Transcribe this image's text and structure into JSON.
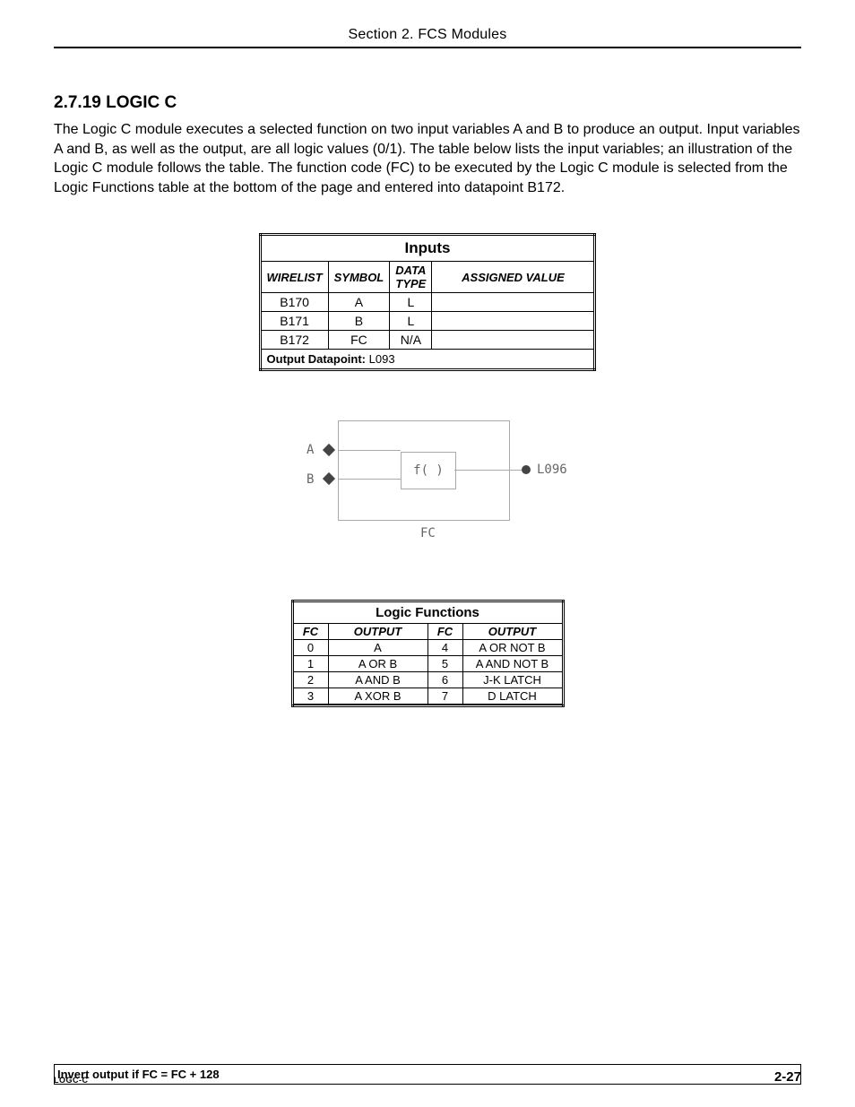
{
  "header": {
    "section_title": "Section 2. FCS Modules"
  },
  "chapter": {
    "number_title": "2.7.19  LOGIC C",
    "body": "The Logic C module executes a selected function on two input variables A and B to produce an output.  Input variables A and B, as well as the output, are all logic values (0/1).  The table below lists the input variables; an illustration of the Logic C module follows the table.  The function code (FC) to be executed by the Logic C module is selected from the Logic Functions table at the bottom of the page and entered into datapoint B172."
  },
  "inputs_table": {
    "title": "Inputs",
    "headers": {
      "wirelist": "WIRELIST",
      "symbol": "SYMBOL",
      "datatype_line1": "DATA",
      "datatype_line2": "TYPE",
      "assigned": "ASSIGNED VALUE"
    },
    "rows": [
      {
        "wirelist": "B170",
        "symbol": "A",
        "datatype": "L",
        "assigned": ""
      },
      {
        "wirelist": "B171",
        "symbol": "B",
        "datatype": "L",
        "assigned": ""
      },
      {
        "wirelist": "B172",
        "symbol": "FC",
        "datatype": "N/A",
        "assigned": ""
      }
    ],
    "output_label": "Output Datapoint:",
    "output_value": " L093"
  },
  "diagram": {
    "input_a": "A",
    "input_b": "B",
    "func": "f( )",
    "fc_label": "FC",
    "output": "L096"
  },
  "logic_functions": {
    "title": "Logic Functions",
    "headers": {
      "fc": "FC",
      "output": "OUTPUT"
    },
    "rows": [
      {
        "fc1": "0",
        "out1": "A",
        "fc2": "4",
        "out2": "A OR NOT B"
      },
      {
        "fc1": "1",
        "out1": "A OR B",
        "fc2": "5",
        "out2": "A AND NOT B"
      },
      {
        "fc1": "2",
        "out1": "A AND B",
        "fc2": "6",
        "out2": "J-K LATCH"
      },
      {
        "fc1": "3",
        "out1": "A XOR B",
        "fc2": "7",
        "out2": "D LATCH"
      }
    ],
    "footer": "Invert output if FC = FC + 128"
  },
  "footer": {
    "left": "LOGC-C",
    "right": "2-27"
  }
}
